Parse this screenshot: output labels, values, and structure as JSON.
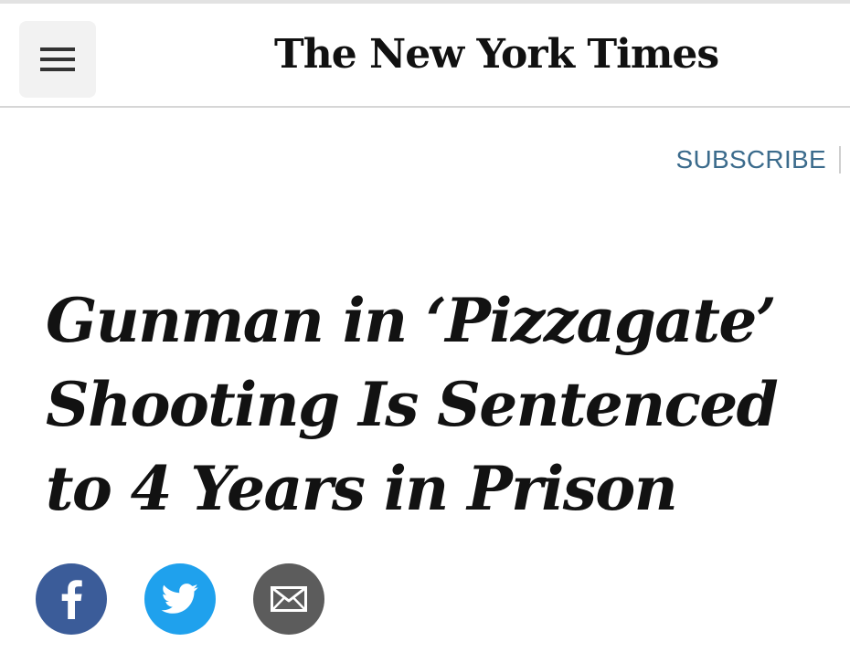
{
  "header": {
    "menu_icon": "hamburger-menu-icon",
    "masthead": "The New York Times"
  },
  "subscribe": {
    "label": "SUBSCRIBE"
  },
  "article": {
    "headline": "Gunman in ‘Pizzagate’ Shooting Is Sentenced to 4 Years in Prison"
  },
  "share": {
    "facebook_icon": "facebook-icon",
    "twitter_icon": "twitter-icon",
    "email_icon": "envelope-icon"
  },
  "colors": {
    "subscribe": "#3b6b8c",
    "facebook": "#3b5c99",
    "twitter": "#1fa1ed",
    "email": "#5c5c5c",
    "headline": "#121212",
    "menu_bg": "#f2f2f2"
  }
}
